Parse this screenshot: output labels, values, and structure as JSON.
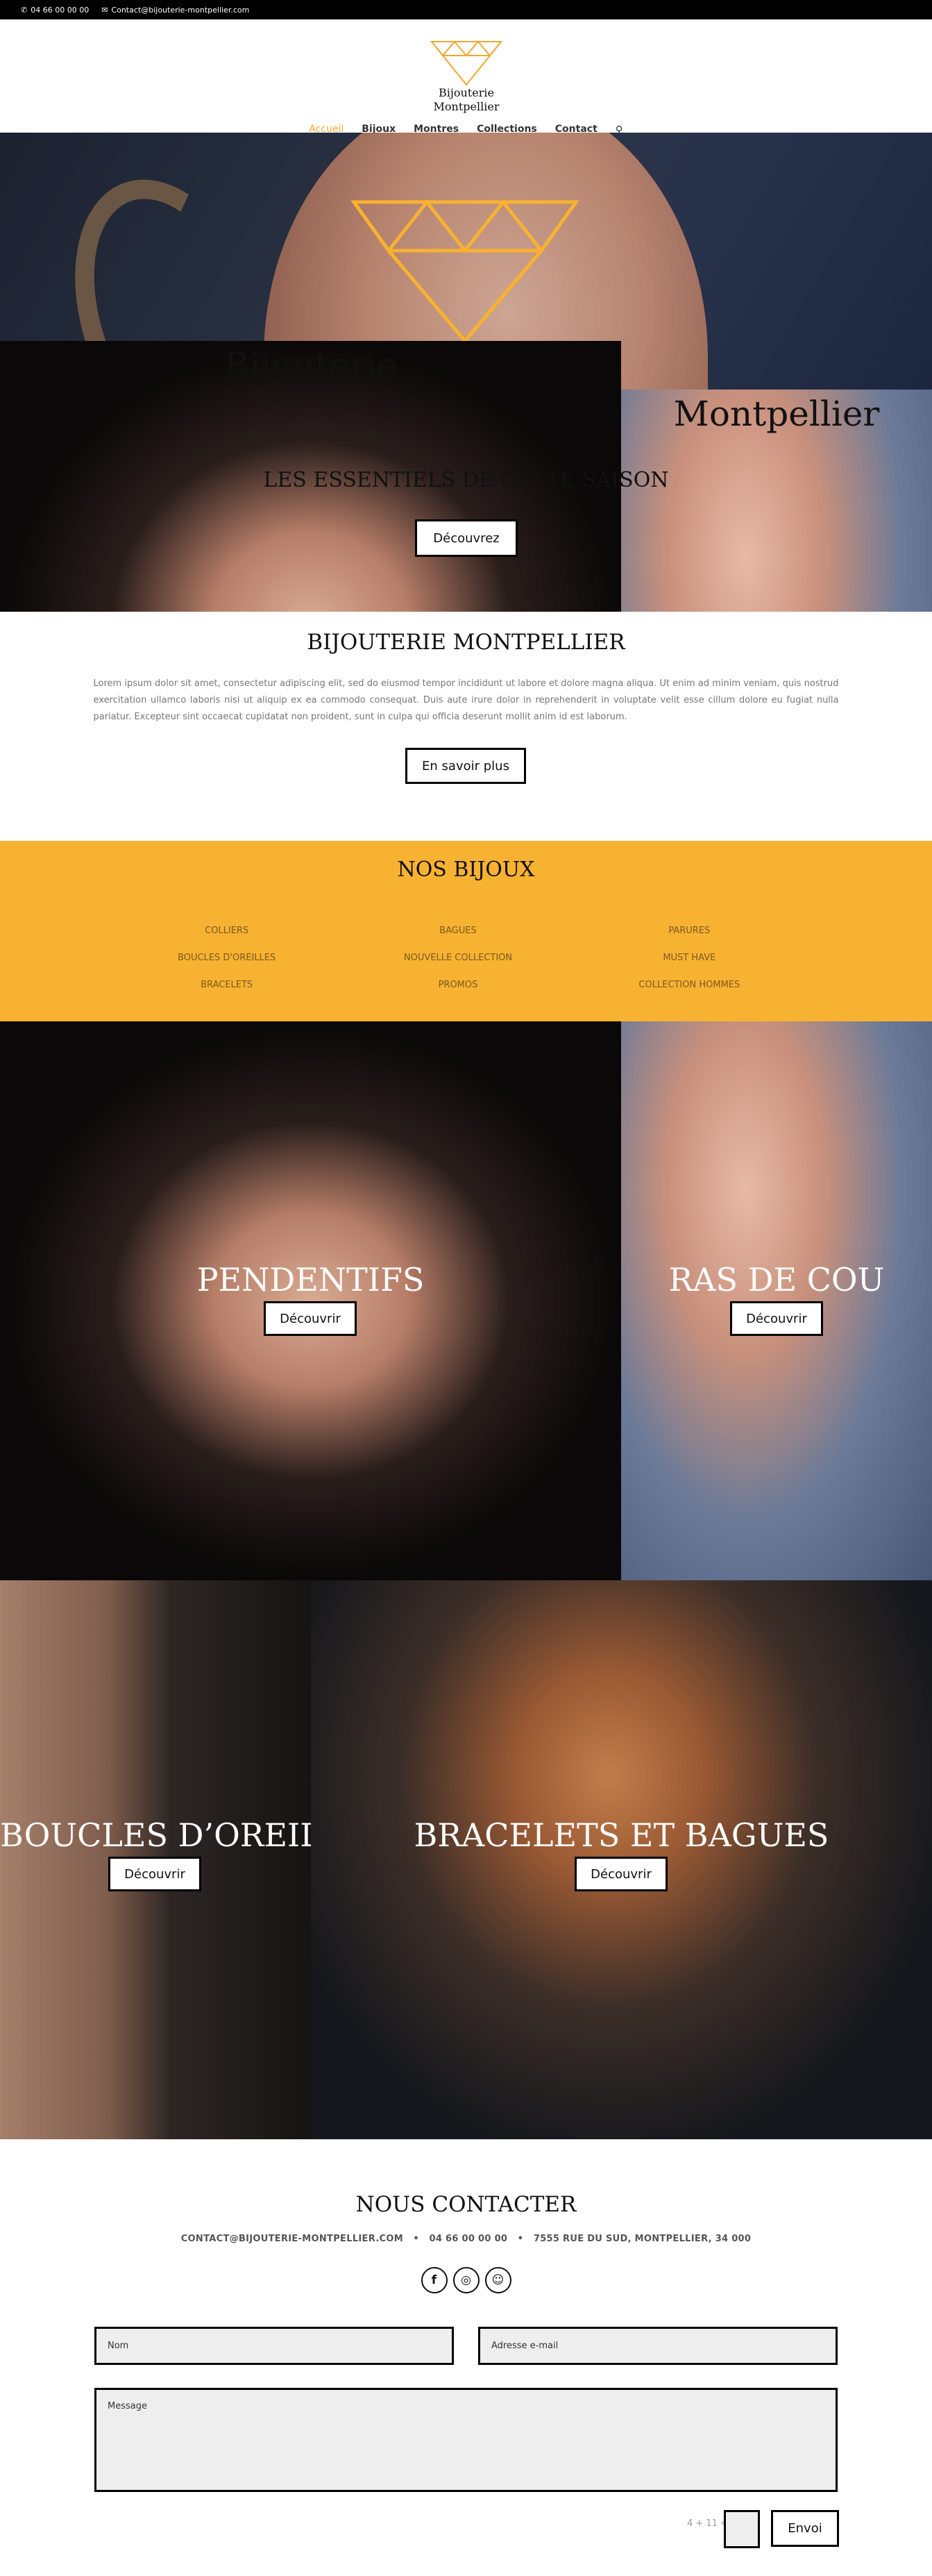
{
  "topbar": {
    "phone_icon": "phone-icon",
    "phone": "04 66 00 00 00",
    "mail_icon": "envelope-icon",
    "email": "Contact@bijouterie-montpellier.com"
  },
  "header": {
    "logo_line1": "Bijouterie",
    "logo_line2": "Montpellier",
    "nav": [
      {
        "label": "Accueil",
        "active": true
      },
      {
        "label": "Bijoux",
        "active": false
      },
      {
        "label": "Montres",
        "active": false
      },
      {
        "label": "Collections",
        "active": false
      },
      {
        "label": "Contact",
        "active": false
      }
    ],
    "search_icon": "search-icon"
  },
  "hero": {
    "title_line1": "Bijouterie",
    "title_line2": "Montpellier",
    "subtitle": "LES ESSENTIELS DE CETTE SAISON",
    "button": "Découvrez"
  },
  "about": {
    "title": "BIJOUTERIE MONTPELLIER",
    "text": "Lorem ipsum dolor sit amet, consectetur adipiscing elit, sed do eiusmod tempor incididunt ut labore et dolore magna aliqua. Ut enim ad minim veniam, quis nostrud exercitation ullamco laboris nisi ut aliquip ex ea commodo consequat. Duis aute irure dolor in reprehenderit in voluptate velit esse cillum dolore eu fugiat nulla pariatur. Excepteur sint occaecat cupidatat non proident, sunt in culpa qui officia deserunt mollit anim id est laborum.",
    "button": "En savoir plus"
  },
  "nos_bijoux": {
    "title": "NOS BIJOUX",
    "categories": [
      "COLLIERS",
      "BAGUES",
      "PARURES",
      "BOUCLES D'OREILLES",
      "NOUVELLE COLLECTION",
      "MUST HAVE",
      "BRACELETS",
      "PROMOS",
      "COLLECTION HOMMES"
    ]
  },
  "tiles": [
    {
      "label": "PENDENTIFS",
      "button": "Découvrir"
    },
    {
      "label": "RAS DE COU",
      "button": "Découvrir"
    },
    {
      "label": "BOUCLES D’OREILLES",
      "button": "Découvrir"
    },
    {
      "label": "BRACELETS ET BAGUES",
      "button": "Découvrir"
    }
  ],
  "contact": {
    "title": "NOUS CONTACTER",
    "info": "CONTACT@BIJOUTERIE-MONTPELLIER.COM   •   04 66 00 00 00   •   7555 RUE DU SUD, MONTPELLIER, 34 000",
    "social": [
      {
        "icon": "facebook-icon",
        "glyph": "f"
      },
      {
        "icon": "instagram-icon",
        "glyph": "◎"
      },
      {
        "icon": "snapchat-icon",
        "glyph": "☺"
      }
    ],
    "name_placeholder": "Nom",
    "email_placeholder": "Adresse e-mail",
    "message_placeholder": "Message",
    "captcha": "4 + 11 =",
    "send": "Envoi"
  },
  "colors": {
    "accent": "#f8b231",
    "nav_active": "#f0a830"
  }
}
